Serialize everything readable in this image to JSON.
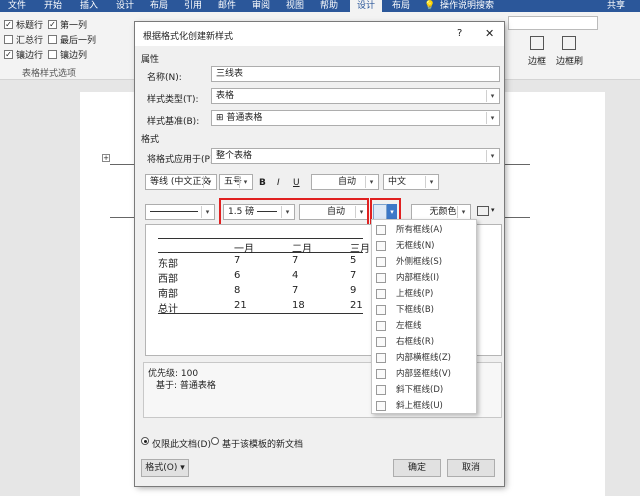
{
  "ribbon": {
    "tabs": [
      "文件",
      "开始",
      "插入",
      "设计",
      "布局",
      "引用",
      "邮件",
      "审阅",
      "视图",
      "帮助",
      "设计",
      "布局"
    ],
    "active_tab_index": 10,
    "search_label": "操作说明搜索",
    "share_label": "共享",
    "options": [
      {
        "label": "标题行",
        "checked": true
      },
      {
        "label": "第一列",
        "checked": true
      },
      {
        "label": "汇总行",
        "checked": false
      },
      {
        "label": "最后一列",
        "checked": false
      },
      {
        "label": "镶边行",
        "checked": true
      },
      {
        "label": "镶边列",
        "checked": false
      }
    ],
    "group_label": "表格样式选项",
    "right_buttons": [
      "边框",
      "边框刷"
    ]
  },
  "dialog": {
    "title": "根据格式化创建新样式",
    "help_icon": "?",
    "close_icon": "✕",
    "section_properties": "属性",
    "name_label": "名称(N):",
    "name_value": "三线表",
    "type_label": "样式类型(T):",
    "type_value": "表格",
    "base_label": "样式基准(B):",
    "base_value": "⊞ 普通表格",
    "section_format": "格式",
    "apply_label": "将格式应用于(P):",
    "apply_value": "整个表格",
    "font_value": "等线 (中文正文",
    "size_value": "五号",
    "bold": "B",
    "italic": "I",
    "underline": "U",
    "color_value": "自动",
    "lang_value": "中文",
    "border_width": "1.5 磅",
    "border_color": "自动",
    "shading": "无颜色",
    "preview": {
      "headers": [
        "",
        "一月",
        "二月",
        "三月"
      ],
      "rows": [
        [
          "东部",
          "7",
          "7",
          "5"
        ],
        [
          "西部",
          "6",
          "4",
          "7"
        ],
        [
          "南部",
          "8",
          "7",
          "9"
        ],
        [
          "总计",
          "21",
          "18",
          "21"
        ]
      ]
    },
    "desc_line1": "优先级: 100",
    "desc_line2": "基于: 普通表格",
    "radio_only_doc": "仅限此文档(D)",
    "radio_template": "基于该模板的新文档",
    "format_button": "格式(O) ▾",
    "ok_button": "确定",
    "cancel_button": "取消"
  },
  "border_menu": {
    "items": [
      "所有框线(A)",
      "无框线(N)",
      "外侧框线(S)",
      "内部框线(I)",
      "上框线(P)",
      "下框线(B)",
      "左框线",
      "右框线(R)",
      "内部横框线(Z)",
      "内部竖框线(V)",
      "斜下框线(D)",
      "斜上框线(U)"
    ]
  },
  "colors": {
    "ribbon": "#2b579a",
    "highlight": "#e02020",
    "dropdown_selected": "#3c78c8"
  }
}
